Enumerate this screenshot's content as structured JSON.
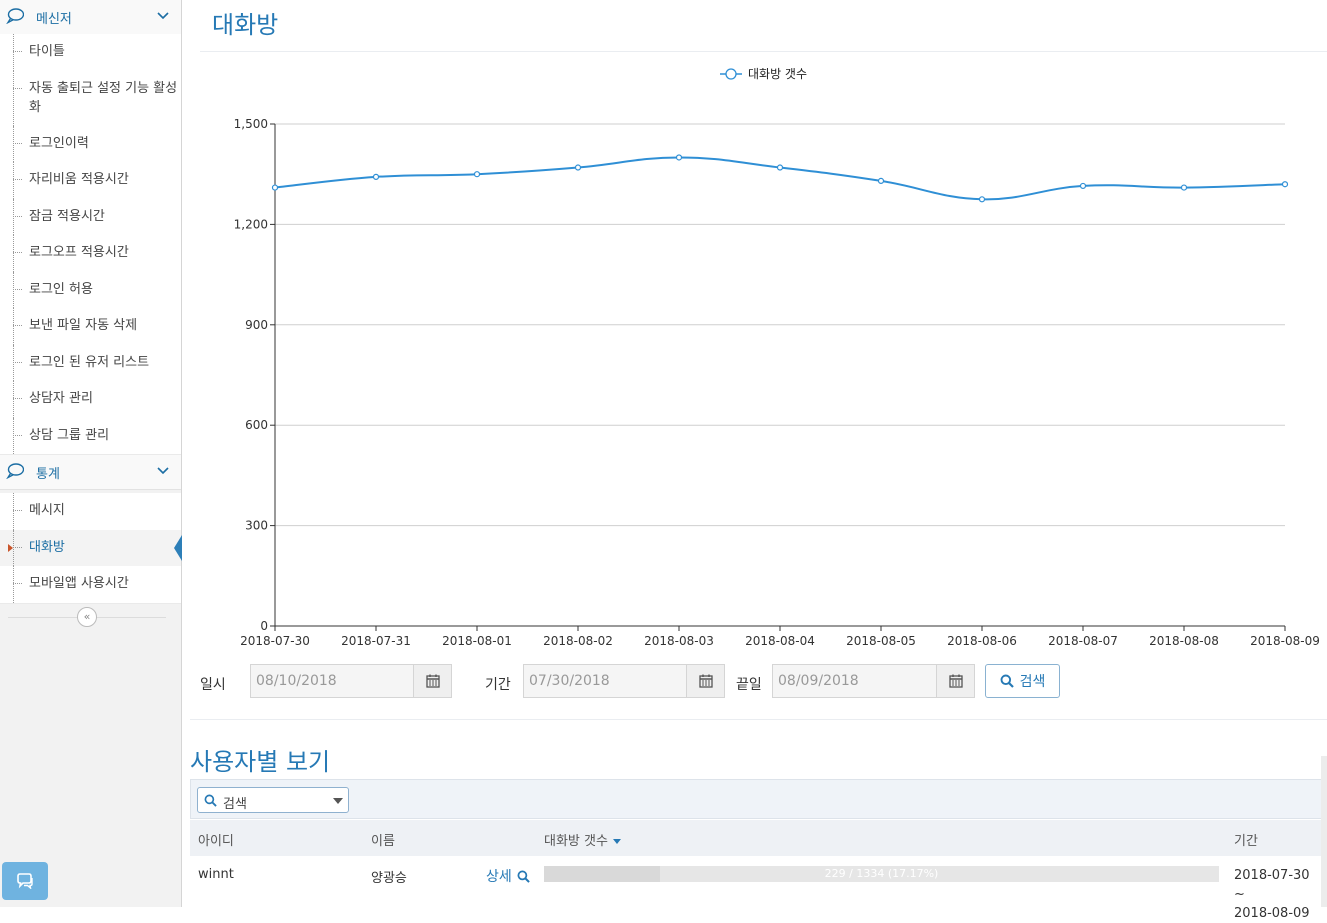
{
  "sidebar": {
    "sections": [
      {
        "title": "메신저",
        "icon": "chat-bubble-icon"
      },
      {
        "title": "통계",
        "icon": "chat-bubble-icon"
      }
    ],
    "messenger_items": [
      "타이틀",
      "자동 출퇴근 설정 기능 활성화",
      "로그인이력",
      "자리비움 적용시간",
      "잠금 적용시간",
      "로그오프 적용시간",
      "로그인 허용",
      "보낸 파일 자동 삭제",
      "로그인 된 유저 리스트",
      "상담자 관리",
      "상담 그룹 관리"
    ],
    "stats_items": [
      "메시지",
      "대화방",
      "모바일앱 사용시간"
    ],
    "active_item": "대화방",
    "collapse_icon": "double-chevron-left-icon"
  },
  "page": {
    "title": "대화방"
  },
  "chart_data": {
    "type": "line",
    "x": [
      "2018-07-30",
      "2018-07-31",
      "2018-08-01",
      "2018-08-02",
      "2018-08-03",
      "2018-08-04",
      "2018-08-05",
      "2018-08-06",
      "2018-08-07",
      "2018-08-08",
      "2018-08-09"
    ],
    "series": [
      {
        "name": "대화방 갯수",
        "values": [
          1310,
          1342,
          1350,
          1370,
          1400,
          1370,
          1330,
          1275,
          1315,
          1310,
          1320
        ],
        "color": "#2f8fd5"
      }
    ],
    "yticks": [
      "0",
      "300",
      "600",
      "900",
      "1,200",
      "1,500"
    ],
    "ylim": [
      0,
      1500
    ],
    "grid": true,
    "legend": "top-center"
  },
  "filters": {
    "date_label": "일시",
    "date_value": "08/10/2018",
    "from_label": "기간",
    "from_value": "07/30/2018",
    "to_label": "끝일",
    "to_value": "08/09/2018",
    "search_label": "검색"
  },
  "user_view": {
    "title": "사용자별 보기",
    "search_select": "검색",
    "columns": {
      "id": "아이디",
      "name": "이름",
      "count": "대화방 갯수",
      "period": "기간"
    },
    "rows": [
      {
        "id": "winnt",
        "name": "양광승",
        "detail": "상세",
        "progress_text": "229 / 1334 (17.17%)",
        "progress": 0.1717,
        "period_start": "2018-07-30 ~",
        "period_end": "2018-08-09"
      }
    ]
  },
  "colors": {
    "accent": "#2679b5",
    "line": "#2f8fd5",
    "chat_button": "#6fb3e0"
  }
}
